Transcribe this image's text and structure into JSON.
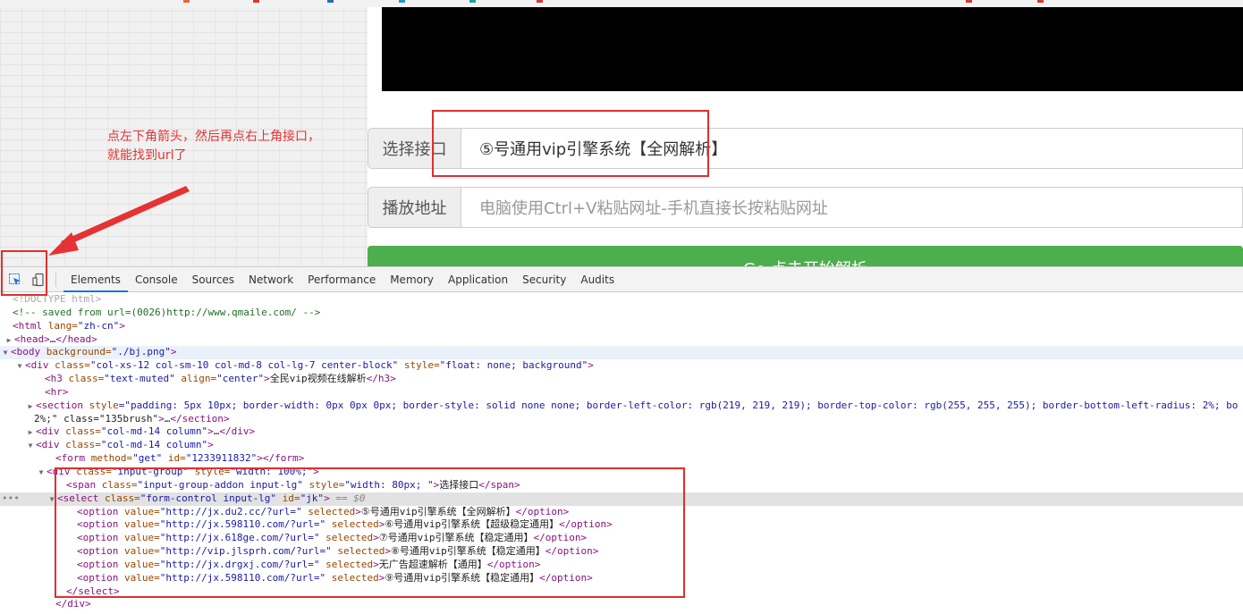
{
  "page": {
    "interface_label": "选择接口",
    "interface_value": "⑤号通用vip引擎系统【全网解析】",
    "url_label": "播放地址",
    "url_placeholder": "电脑使用Ctrl+V粘贴网址-手机直接长按粘贴网址",
    "go_button_label": "Go 点击开始解析",
    "annotation_line1": "点左下角箭头，然后再点右上角接口，",
    "annotation_line2": "就能找到url了",
    "colors": {
      "highlight": "#e02f2f",
      "annotation": "#e53333",
      "go_button": "#4cae4c"
    }
  },
  "devtools": {
    "tabs": [
      "Elements",
      "Console",
      "Sources",
      "Network",
      "Performance",
      "Memory",
      "Application",
      "Security",
      "Audits"
    ],
    "active_tab": "Elements",
    "icons": [
      "inspect-element-icon",
      "device-toolbar-icon"
    ],
    "lines": [
      "<!DOCTYPE html>",
      "<!-- saved from url=(0026)http://www.qmaile.com/ -->",
      "<html lang=\"zh-cn\">",
      "<head>…</head>",
      "<body background=\"./bj.png\">",
      "<div class=\"col-xs-12 col-sm-10 col-md-8 col-lg-7 center-block\" style=\"float: none; background\">",
      "<h3 class=\"text-muted\" align=\"center\">全民vip视频在线解析</h3>",
      "<hr>",
      "<section style=\"padding: 5px 10px; border-width: 0px 0px 0px; border-style: solid none none; border-left-color: rgb(219, 219, 219); border-top-color: rgb(255, 255, 255); border-bottom-left-radius: 2%; bo",
      "2%;\" class=\"135brush\">…</section>",
      "<div class=\"col-md-14 column\">…</div>",
      "<div class=\"col-md-14 column\">",
      "<form method=\"get\" id=\"1233911832\"></form>",
      "<div class=\"input-group\" style=\"width: 100%;\">",
      "<span class=\"input-group-addon input-lg\" style=\"width: 80px; \">选择接口</span>",
      "<select class=\"form-control input-lg\" id=\"jk\"> == $0",
      "<option value=\"http://jx.du2.cc/?url=\" selected>⑤号通用vip引擎系统【全网解析】</option>",
      "<option value=\"http://jx.598110.com/?url=\" selected>⑥号通用vip引擎系统【超级稳定通用】</option>",
      "<option value=\"http://jx.618ge.com/?url=\" selected>⑦号通用vip引擎系统【稳定通用】</option>",
      "<option value=\"http://vip.jlsprh.com/?url=\" selected>⑧号通用vip引擎系统【稳定通用】</option>",
      "<option value=\"http://jx.drgxj.com/?url=\" selected>无广告超速解析【通用】</option>",
      "<option value=\"http://jx.598110.com/?url=\" selected>⑨号通用vip引擎系统【稳定通用】</option>",
      "</select>",
      "</div>"
    ]
  }
}
